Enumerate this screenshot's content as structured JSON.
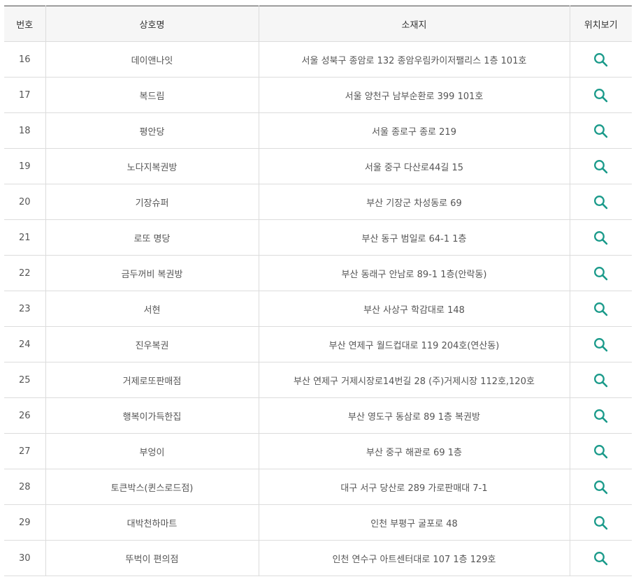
{
  "table": {
    "headers": {
      "number": "번호",
      "store_name": "상호명",
      "address": "소재지",
      "location": "위치보기"
    },
    "rows": [
      {
        "number": "16",
        "name": "데이앤나잇",
        "address": "서울 성북구 종암로 132 종암우림카이저팰리스 1층 101호"
      },
      {
        "number": "17",
        "name": "복드림",
        "address": "서울 양천구 남부순환로 399 101호"
      },
      {
        "number": "18",
        "name": "평안당",
        "address": "서울 종로구 종로 219"
      },
      {
        "number": "19",
        "name": "노다지복권방",
        "address": "서울 중구 다산로44길 15"
      },
      {
        "number": "20",
        "name": "기장슈퍼",
        "address": "부산 기장군 차성동로 69"
      },
      {
        "number": "21",
        "name": "로또 명당",
        "address": "부산 동구 범일로 64-1 1층"
      },
      {
        "number": "22",
        "name": "금두꺼비 복권방",
        "address": "부산 동래구 안남로 89-1 1층(안락동)"
      },
      {
        "number": "23",
        "name": "서현",
        "address": "부산 사상구 학감대로 148"
      },
      {
        "number": "24",
        "name": "진우복권",
        "address": "부산 연제구 월드컵대로 119 204호(연산동)"
      },
      {
        "number": "25",
        "name": "거제로또판매점",
        "address": "부산 연제구 거제시장로14번길 28 (주)거제시장 112호,120호"
      },
      {
        "number": "26",
        "name": "행복이가득한집",
        "address": "부산 영도구 동삼로 89 1층 복권방"
      },
      {
        "number": "27",
        "name": "부엉이",
        "address": "부산 중구 해관로 69 1층"
      },
      {
        "number": "28",
        "name": "토큰박스(퀸스로드점)",
        "address": "대구 서구 당산로 289 가로판매대 7-1"
      },
      {
        "number": "29",
        "name": "대박천하마트",
        "address": "인천 부평구 굴포로 48"
      },
      {
        "number": "30",
        "name": "뚜벅이 편의점",
        "address": "인천 연수구 아트센터대로 107 1층 129호"
      }
    ],
    "location_icon": "search-icon"
  },
  "colors": {
    "icon": "#1a9a8a",
    "header_bg": "#f6f6f6",
    "border": "#dcdcdc",
    "top_border": "#4a4a4a"
  }
}
